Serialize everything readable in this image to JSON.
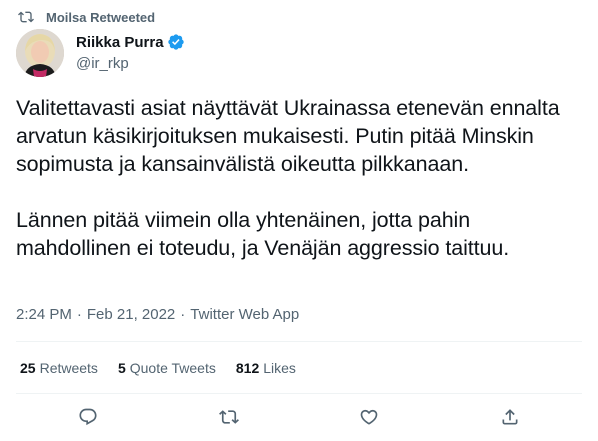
{
  "retweet_banner": {
    "icon": "retweet-icon",
    "text": "Moilsa Retweeted"
  },
  "author": {
    "name": "Riikka Purra",
    "handle": "@ir_rkp",
    "verified": true,
    "verified_color": "#1d9bf0"
  },
  "tweet": {
    "paragraph_1": "Valitettavasti asiat näyttävät Ukrainassa etenevän ennalta arvatun käsikirjoituksen mukaisesti. Putin pitää Minskin sopimusta ja kansainvälistä oikeutta pilkkanaan.",
    "paragraph_2": "Lännen pitää viimein olla yhtenäinen, jotta pahin mahdollinen ei toteudu, ja Venäjän aggressio taittuu."
  },
  "meta": {
    "time": "2:24 PM",
    "separator": "·",
    "date": "Feb 21, 2022",
    "source": "Twitter Web App"
  },
  "stats": {
    "retweets_count": "25",
    "retweets_label": "Retweets",
    "quotes_count": "5",
    "quotes_label": "Quote Tweets",
    "likes_count": "812",
    "likes_label": "Likes"
  },
  "actions": [
    "reply-icon",
    "retweet-icon",
    "like-icon",
    "share-icon"
  ],
  "colors": {
    "text": "#0f1419",
    "secondary": "#536471",
    "divider": "#eff3f4"
  }
}
